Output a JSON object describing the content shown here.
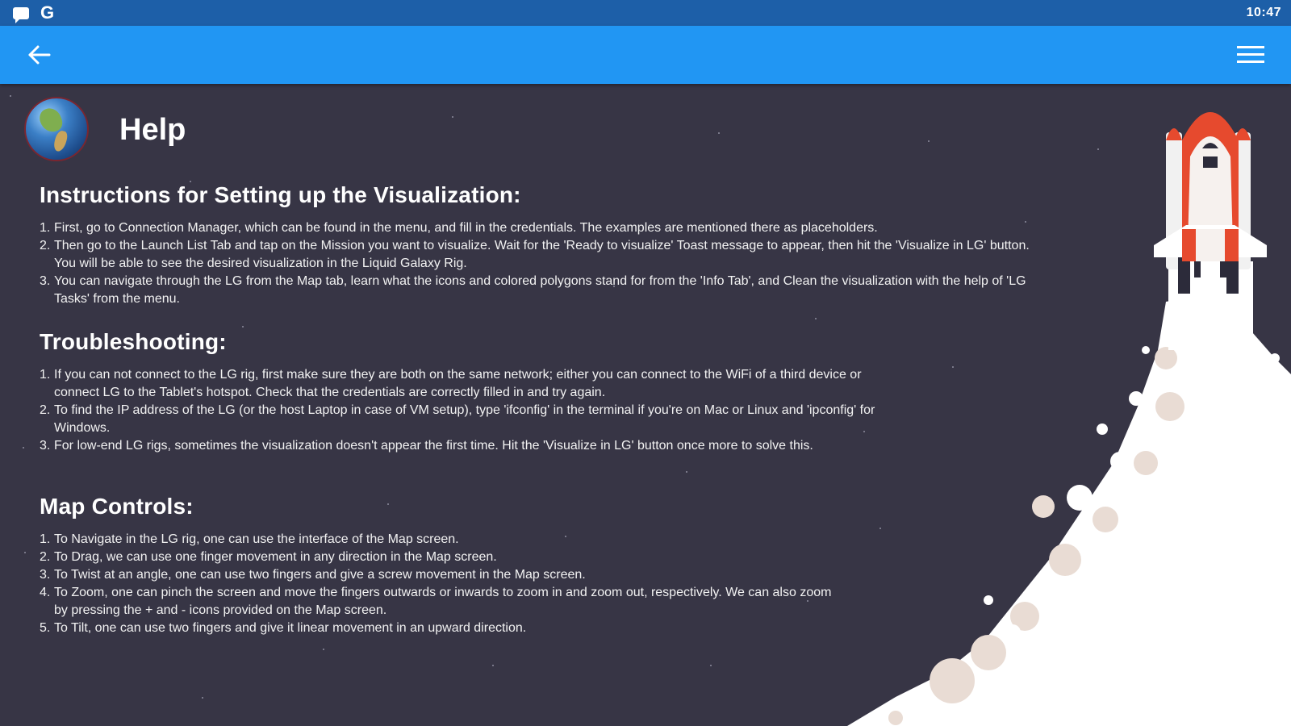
{
  "status_bar": {
    "time": "10:47",
    "icons": [
      "message-icon",
      "google-icon"
    ],
    "google_glyph": "G"
  },
  "app_bar": {
    "back_icon": "arrow-left-icon",
    "menu_icon": "hamburger-menu-icon",
    "color": "#2196f3"
  },
  "page": {
    "title": "Help",
    "logo": "globe-icon",
    "background": "#373545"
  },
  "sections": [
    {
      "heading": "Instructions for Setting up the Visualization:",
      "items": [
        {
          "num": "1.",
          "text": "First, go to Connection Manager, which can be found in the menu, and fill in the credentials. The examples are mentioned there as placeholders."
        },
        {
          "num": "2.",
          "text": "Then go to the Launch List Tab and tap on the Mission you want to visualize. Wait for the 'Ready to visualize' Toast message to appear, then hit the 'Visualize in LG' button. You will be able to see the desired visualization in the Liquid Galaxy Rig."
        },
        {
          "num": "3.",
          "text": "You can navigate through the LG from the Map tab, learn what the icons and colored polygons stand for from the 'Info Tab', and Clean the visualization with the help of 'LG Tasks' from the menu."
        }
      ]
    },
    {
      "heading": "Troubleshooting:",
      "items": [
        {
          "num": "1.",
          "text": "If you can not connect to the LG rig, first make sure they are both on the same network; either you can connect to the WiFi of a third device or connect LG to the Tablet's hotspot. Check that the credentials are correctly filled in and try again."
        },
        {
          "num": "2.",
          "text": "To find the IP address of the LG (or the host Laptop in case of VM setup), type 'ifconfig' in the terminal if you're on Mac or Linux and 'ipconfig' for Windows."
        },
        {
          "num": "3.",
          "text": "For low-end LG rigs, sometimes the visualization doesn't appear the first time. Hit the 'Visualize in LG' button once more to solve this."
        }
      ]
    },
    {
      "heading": "Map Controls:",
      "items": [
        {
          "num": "1.",
          "text": "To Navigate in the LG rig, one can use the interface of the Map screen."
        },
        {
          "num": "2.",
          "text": "To Drag, we can use one finger movement in any direction in the Map screen."
        },
        {
          "num": "3.",
          "text": "To Twist at an angle, one can use two fingers and give a screw movement in the Map screen."
        },
        {
          "num": "4.",
          "text": "To Zoom, one can pinch the screen and move the fingers outwards or inwards to zoom in and zoom out, respectively. We can also zoom by pressing the + and - icons provided on the Map screen."
        },
        {
          "num": "5.",
          "text": "To Tilt, one can use two fingers and give it linear movement in an upward direction."
        }
      ]
    }
  ],
  "illustration": "rocket-launch-illustration"
}
